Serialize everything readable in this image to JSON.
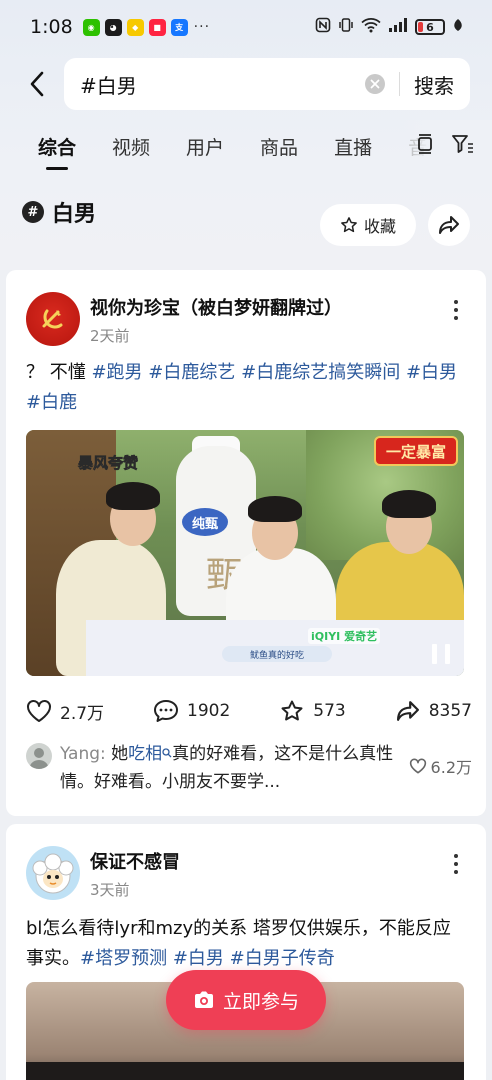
{
  "status_bar": {
    "time": "1:08",
    "apps": [
      {
        "icon": "wechat-icon",
        "color": "#2dc100",
        "glyph": "◉"
      },
      {
        "icon": "qq-icon",
        "color": "#1c1c1c",
        "glyph": "◕"
      },
      {
        "icon": "app-yellow-icon",
        "color": "#f7c900",
        "glyph": "◆"
      },
      {
        "icon": "xiaohongshu-icon",
        "color": "#ff2442",
        "glyph": "■"
      },
      {
        "icon": "alipay-icon",
        "color": "#1677ff",
        "glyph": "支"
      }
    ],
    "more": "···",
    "battery": "6"
  },
  "search": {
    "query": "#白男",
    "submit_label": "搜索"
  },
  "tabs": [
    {
      "label": "综合",
      "active": true
    },
    {
      "label": "视频",
      "active": false
    },
    {
      "label": "用户",
      "active": false
    },
    {
      "label": "商品",
      "active": false
    },
    {
      "label": "直播",
      "active": false
    },
    {
      "label": "音",
      "active": false
    }
  ],
  "topic": {
    "hash": "#",
    "name": "白男",
    "collect_label": "收藏"
  },
  "posts": [
    {
      "author": "视你为珍宝（被白梦妍翻牌过）",
      "time": "2天前",
      "text_prefix": "？ 不懂 ",
      "tags": [
        "#跑男",
        "#白鹿综艺",
        "#白鹿综艺搞笑瞬间",
        "#白男",
        "#白鹿"
      ],
      "video": {
        "caption_left": "暴风夸赞",
        "badge": "一定暴富",
        "bottle_label": "纯甄",
        "bottle_char": "甄",
        "subtitle": "鱿鱼真的好吃",
        "platform": "iQIYI 爱奇艺"
      },
      "stats": {
        "likes": "2.7万",
        "comments": "1902",
        "favorites": "573",
        "shares": "8357"
      },
      "top_comment": {
        "user": "Yang:",
        "text_before": "她",
        "link": "吃相",
        "text_after": "真的好难看，这不是什么真性情。好难看。小朋友不要学...",
        "likes": "6.2万"
      }
    },
    {
      "author": "保证不感冒",
      "time": "3天前",
      "text_prefix": "bl怎么看待lyr和mzy的关系 塔罗仅供娱乐，不能反应事实。",
      "tags": [
        "#塔罗预测",
        "#白男",
        "#白男子传奇"
      ]
    }
  ],
  "fab": {
    "label": "立即参与"
  },
  "colors": {
    "accent": "#ef3f55",
    "tag": "#2d5a9c",
    "muted": "#888888"
  }
}
